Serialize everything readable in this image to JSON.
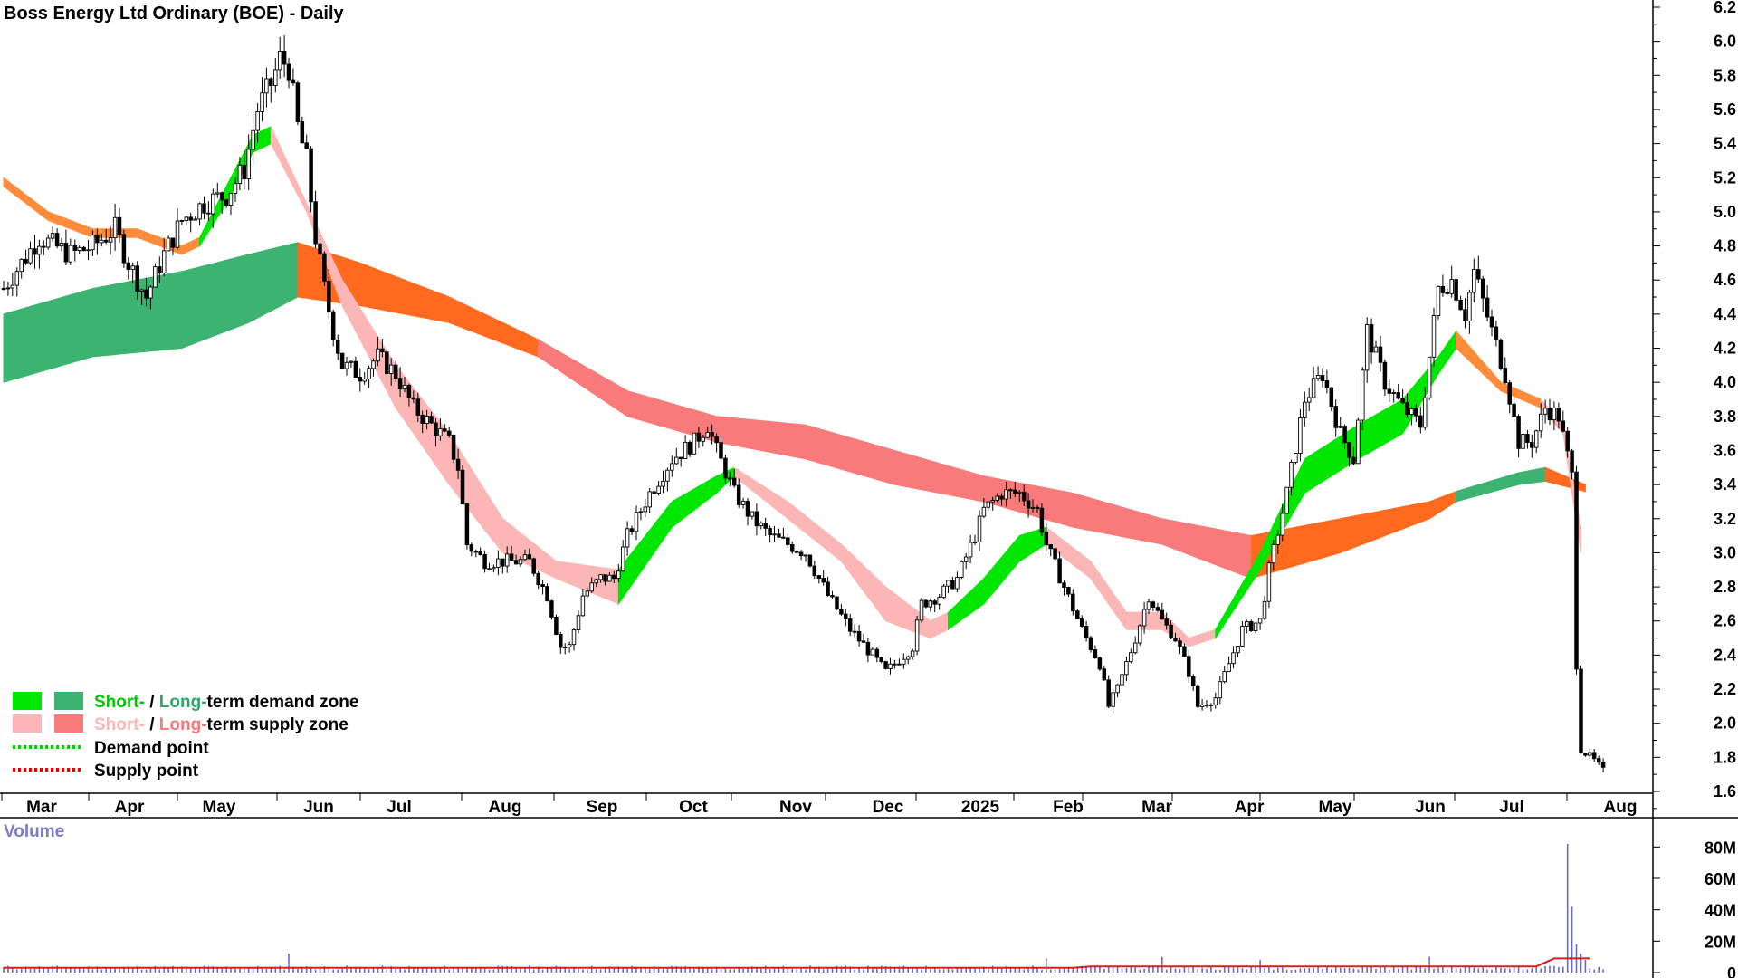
{
  "chart_data": {
    "type": "candlestick",
    "title": "Boss Energy Ltd Ordinary (BOE) - Daily",
    "y_ticks": [
      "6.2",
      "6.0",
      "5.8",
      "5.6",
      "5.4",
      "5.2",
      "5.0",
      "4.8",
      "4.6",
      "4.4",
      "4.2",
      "4.0",
      "3.8",
      "3.6",
      "3.4",
      "3.2",
      "3.0",
      "2.8",
      "2.6",
      "2.4",
      "2.2",
      "2.0",
      "1.8",
      "1.6"
    ],
    "ylim": [
      1.6,
      6.2
    ],
    "x_labels": [
      "Mar",
      "Apr",
      "May",
      "Jun",
      "Jul",
      "Aug",
      "Sep",
      "Oct",
      "Nov",
      "Dec",
      "2025",
      "Feb",
      "Mar",
      "Apr",
      "May",
      "Jun",
      "Jul",
      "Aug"
    ],
    "price_path": [
      [
        0,
        4.55
      ],
      [
        8,
        4.85
      ],
      [
        15,
        4.75
      ],
      [
        20,
        4.8
      ],
      [
        25,
        4.9
      ],
      [
        28,
        4.7
      ],
      [
        32,
        4.5
      ],
      [
        36,
        4.75
      ],
      [
        40,
        4.95
      ],
      [
        45,
        5.05
      ],
      [
        50,
        5.1
      ],
      [
        54,
        5.25
      ],
      [
        57,
        5.6
      ],
      [
        60,
        5.75
      ],
      [
        62,
        5.9
      ],
      [
        64,
        5.85
      ],
      [
        66,
        5.5
      ],
      [
        68,
        5.3
      ],
      [
        70,
        4.85
      ],
      [
        72,
        4.55
      ],
      [
        74,
        4.3
      ],
      [
        76,
        4.1
      ],
      [
        80,
        4.05
      ],
      [
        84,
        4.15
      ],
      [
        88,
        4.05
      ],
      [
        92,
        3.85
      ],
      [
        96,
        3.75
      ],
      [
        100,
        3.65
      ],
      [
        102,
        3.5
      ],
      [
        104,
        3.05
      ],
      [
        108,
        2.95
      ],
      [
        112,
        2.95
      ],
      [
        118,
        2.95
      ],
      [
        122,
        2.75
      ],
      [
        125,
        2.45
      ],
      [
        127,
        2.45
      ],
      [
        130,
        2.75
      ],
      [
        134,
        2.85
      ],
      [
        137,
        2.85
      ],
      [
        140,
        3.1
      ],
      [
        145,
        3.35
      ],
      [
        150,
        3.55
      ],
      [
        155,
        3.65
      ],
      [
        158,
        3.75
      ],
      [
        160,
        3.6
      ],
      [
        164,
        3.35
      ],
      [
        168,
        3.2
      ],
      [
        172,
        3.1
      ],
      [
        176,
        3.05
      ],
      [
        180,
        3.0
      ],
      [
        185,
        2.75
      ],
      [
        190,
        2.55
      ],
      [
        195,
        2.4
      ],
      [
        198,
        2.3
      ],
      [
        200,
        2.35
      ],
      [
        204,
        2.45
      ],
      [
        206,
        2.7
      ],
      [
        210,
        2.75
      ],
      [
        214,
        2.85
      ],
      [
        218,
        3.1
      ],
      [
        220,
        3.25
      ],
      [
        224,
        3.35
      ],
      [
        228,
        3.35
      ],
      [
        232,
        3.25
      ],
      [
        234,
        3.05
      ],
      [
        238,
        2.8
      ],
      [
        242,
        2.55
      ],
      [
        246,
        2.35
      ],
      [
        248,
        2.1
      ],
      [
        250,
        2.2
      ],
      [
        254,
        2.5
      ],
      [
        257,
        2.75
      ],
      [
        260,
        2.6
      ],
      [
        263,
        2.5
      ],
      [
        266,
        2.3
      ],
      [
        268,
        2.1
      ],
      [
        272,
        2.15
      ],
      [
        275,
        2.35
      ],
      [
        278,
        2.55
      ],
      [
        282,
        2.6
      ],
      [
        284,
        2.9
      ],
      [
        288,
        3.35
      ],
      [
        292,
        3.9
      ],
      [
        296,
        4.05
      ],
      [
        300,
        3.7
      ],
      [
        303,
        3.55
      ],
      [
        306,
        4.3
      ],
      [
        310,
        4.0
      ],
      [
        314,
        3.85
      ],
      [
        318,
        3.75
      ],
      [
        322,
        4.55
      ],
      [
        325,
        4.6
      ],
      [
        328,
        4.4
      ],
      [
        330,
        4.65
      ],
      [
        334,
        4.3
      ],
      [
        337,
        4.05
      ],
      [
        340,
        3.65
      ],
      [
        343,
        3.65
      ],
      [
        346,
        3.85
      ],
      [
        349,
        3.8
      ],
      [
        352,
        3.45
      ],
      [
        353,
        2.35
      ],
      [
        354,
        1.85
      ],
      [
        357,
        1.78
      ],
      [
        359,
        1.72
      ]
    ],
    "zones": [
      {
        "name": "long-term demand zone",
        "color": "#3cb371",
        "points": [
          [
            0,
            4.0,
            4.4
          ],
          [
            20,
            4.15,
            4.55
          ],
          [
            40,
            4.2,
            4.65
          ],
          [
            55,
            4.35,
            4.75
          ],
          [
            66,
            4.5,
            4.82
          ]
        ]
      },
      {
        "name": "long-term supply zone",
        "color": "#ff6a1f",
        "points": [
          [
            66,
            4.5,
            4.82
          ],
          [
            80,
            4.45,
            4.7
          ],
          [
            100,
            4.35,
            4.5
          ],
          [
            120,
            4.15,
            4.25
          ]
        ]
      },
      {
        "name": "long-term supply zone",
        "color": "#f97a7a",
        "points": [
          [
            120,
            4.15,
            4.25
          ],
          [
            140,
            3.8,
            3.95
          ],
          [
            160,
            3.65,
            3.8
          ],
          [
            180,
            3.55,
            3.75
          ],
          [
            200,
            3.4,
            3.6
          ],
          [
            220,
            3.3,
            3.45
          ],
          [
            240,
            3.15,
            3.35
          ],
          [
            260,
            3.05,
            3.2
          ],
          [
            280,
            2.85,
            3.1
          ]
        ]
      },
      {
        "name": "long-term supply zone",
        "color": "#ff6a1f",
        "points": [
          [
            280,
            2.85,
            3.1
          ],
          [
            300,
            3.0,
            3.2
          ],
          [
            320,
            3.2,
            3.3
          ],
          [
            326,
            3.3,
            3.36
          ]
        ]
      },
      {
        "name": "long-term demand zone",
        "color": "#3cb371",
        "points": [
          [
            326,
            3.3,
            3.36
          ],
          [
            340,
            3.4,
            3.47
          ],
          [
            346,
            3.42,
            3.5
          ]
        ]
      },
      {
        "name": "long-term supply zone",
        "color": "#ff6a1f",
        "points": [
          [
            346,
            3.42,
            3.5
          ],
          [
            355,
            3.36,
            3.4
          ]
        ]
      },
      {
        "name": "short-term supply zone",
        "color": "#ff8c3a",
        "points": [
          [
            0,
            5.15,
            5.2
          ],
          [
            10,
            4.95,
            5.0
          ],
          [
            20,
            4.85,
            4.9
          ],
          [
            30,
            4.85,
            4.9
          ],
          [
            40,
            4.75,
            4.8
          ],
          [
            44,
            4.8,
            4.85
          ]
        ]
      },
      {
        "name": "short-term demand zone",
        "color": "#00e600",
        "points": [
          [
            44,
            4.8,
            4.85
          ],
          [
            50,
            5.05,
            5.15
          ],
          [
            56,
            5.35,
            5.45
          ],
          [
            60,
            5.4,
            5.5
          ]
        ]
      },
      {
        "name": "short-term supply zone",
        "color": "#fdb6b6",
        "points": [
          [
            60,
            5.4,
            5.5
          ],
          [
            68,
            5.0,
            5.05
          ],
          [
            76,
            4.45,
            4.6
          ],
          [
            88,
            3.85,
            4.1
          ],
          [
            100,
            3.4,
            3.7
          ],
          [
            112,
            3.0,
            3.2
          ],
          [
            124,
            2.85,
            2.95
          ],
          [
            138,
            2.7,
            2.9
          ]
        ]
      },
      {
        "name": "short-term demand zone",
        "color": "#00e600",
        "points": [
          [
            138,
            2.7,
            2.9
          ],
          [
            150,
            3.15,
            3.3
          ],
          [
            160,
            3.35,
            3.45
          ],
          [
            164,
            3.45,
            3.5
          ]
        ]
      },
      {
        "name": "short-term supply zone",
        "color": "#fdb6b6",
        "points": [
          [
            164,
            3.45,
            3.5
          ],
          [
            176,
            3.2,
            3.3
          ],
          [
            188,
            2.95,
            3.05
          ],
          [
            198,
            2.6,
            2.8
          ],
          [
            208,
            2.5,
            2.6
          ],
          [
            212,
            2.55,
            2.65
          ]
        ]
      },
      {
        "name": "short-term demand zone",
        "color": "#00e600",
        "points": [
          [
            212,
            2.55,
            2.65
          ],
          [
            220,
            2.7,
            2.85
          ],
          [
            228,
            2.95,
            3.1
          ],
          [
            234,
            3.05,
            3.15
          ]
        ]
      },
      {
        "name": "short-term supply zone",
        "color": "#fdb6b6",
        "points": [
          [
            234,
            3.05,
            3.15
          ],
          [
            244,
            2.85,
            2.95
          ],
          [
            252,
            2.55,
            2.65
          ],
          [
            260,
            2.55,
            2.65
          ],
          [
            266,
            2.45,
            2.5
          ],
          [
            272,
            2.5,
            2.55
          ]
        ]
      },
      {
        "name": "short-term demand zone",
        "color": "#00e600",
        "points": [
          [
            272,
            2.5,
            2.55
          ],
          [
            282,
            2.9,
            3.0
          ],
          [
            292,
            3.35,
            3.55
          ],
          [
            304,
            3.55,
            3.75
          ],
          [
            314,
            3.7,
            3.9
          ],
          [
            322,
            4.05,
            4.15
          ],
          [
            326,
            4.2,
            4.3
          ]
        ]
      },
      {
        "name": "short-term supply zone",
        "color": "#ff8c3a",
        "points": [
          [
            326,
            4.2,
            4.3
          ],
          [
            336,
            3.95,
            4.0
          ],
          [
            345,
            3.85,
            3.9
          ]
        ]
      },
      {
        "name": "short-term supply zone",
        "color": "#fdb6b6",
        "points": [
          [
            345,
            3.85,
            3.9
          ],
          [
            350,
            3.7,
            3.75
          ],
          [
            354,
            3.0,
            3.15
          ]
        ]
      }
    ],
    "volume": {
      "label": "Volume",
      "y_ticks": [
        "80M",
        "60M",
        "40M",
        "20M",
        "0"
      ],
      "ylim": [
        0,
        90
      ],
      "spikes": [
        [
          351,
          82
        ],
        [
          352,
          42
        ],
        [
          353,
          18
        ],
        [
          354,
          12
        ],
        [
          355,
          8
        ],
        [
          64,
          12
        ],
        [
          234,
          9
        ],
        [
          260,
          10
        ],
        [
          282,
          8
        ],
        [
          320,
          10
        ]
      ],
      "baseline_level": 3
    },
    "legend": {
      "rows": [
        {
          "swatches": [
            "#00e600",
            "#3cb371"
          ],
          "prefix": "Short-",
          "prefix_color": "#00c800",
          "sep": " / ",
          "mid": "Long-",
          "mid_color": "#2ea86a",
          "suffix": "term demand zone"
        },
        {
          "swatches": [
            "#fdb6b6",
            "#f97a7a"
          ],
          "prefix": "Short-",
          "prefix_color": "#fdb6b6",
          "sep": " / ",
          "mid": "Long-",
          "mid_color": "#f97a7a",
          "suffix": "term supply zone"
        },
        {
          "dotted": "#00d000",
          "label": "Demand point"
        },
        {
          "dotted": "#e00000",
          "label": "Supply point"
        }
      ]
    }
  }
}
